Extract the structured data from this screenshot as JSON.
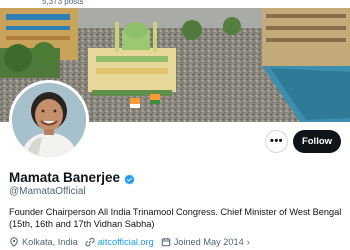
{
  "profile": {
    "posts_count": "5,373 posts",
    "display_name": "Mamata Banerjee",
    "handle": "@MamataOfficial",
    "verified": true,
    "bio": "Founder Chairperson All India Trinamool Congress. Chief Minister of West Bengal (15th, 16th and 17th Vidhan Sabha)",
    "location": "Kolkata, India",
    "website": "aitcofficial.org",
    "joined": "Joined May 2014"
  },
  "actions": {
    "more_label": "•••",
    "follow_label": "Follow"
  },
  "colors": {
    "accent": "#1d9bf0",
    "follow_bg": "#0f1419",
    "muted_text": "#536471"
  },
  "icons": {
    "verified": "verified-badge-icon",
    "location": "location-pin-icon",
    "website": "link-icon",
    "joined": "calendar-icon",
    "more": "more-dots-icon"
  }
}
